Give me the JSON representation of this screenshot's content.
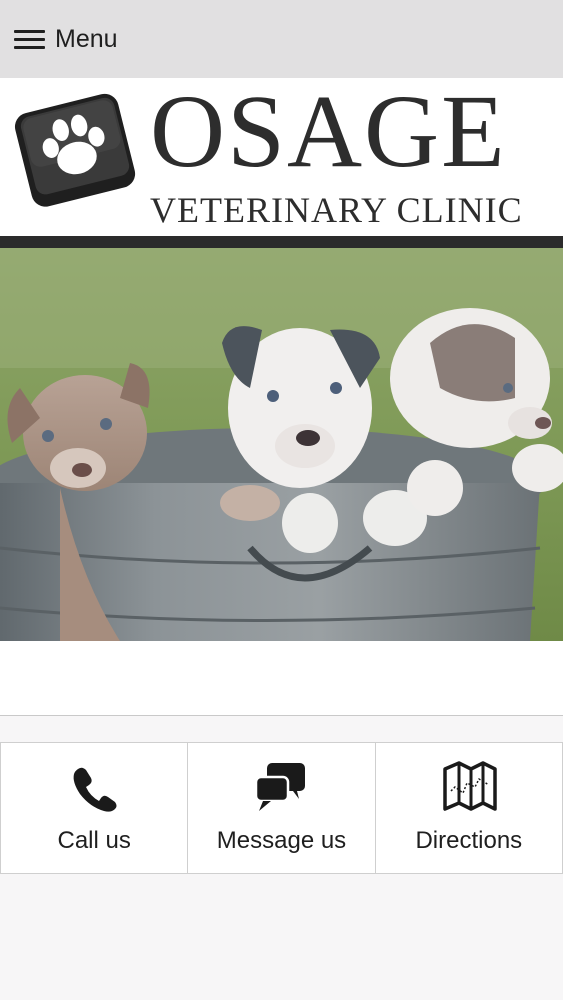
{
  "header": {
    "menu_label": "Menu"
  },
  "logo": {
    "title": "OSAGE",
    "subtitle": "VETERINARY CLINIC",
    "icon": "paw-icon",
    "colors": {
      "dark": "#2d2d2d",
      "bar": "#2b2b2b"
    }
  },
  "hero": {
    "image": "puppies-in-metal-tub"
  },
  "actions": [
    {
      "label": "Call us",
      "icon": "phone-icon"
    },
    {
      "label": "Message us",
      "icon": "chat-bubbles-icon"
    },
    {
      "label": "Directions",
      "icon": "map-icon"
    }
  ]
}
